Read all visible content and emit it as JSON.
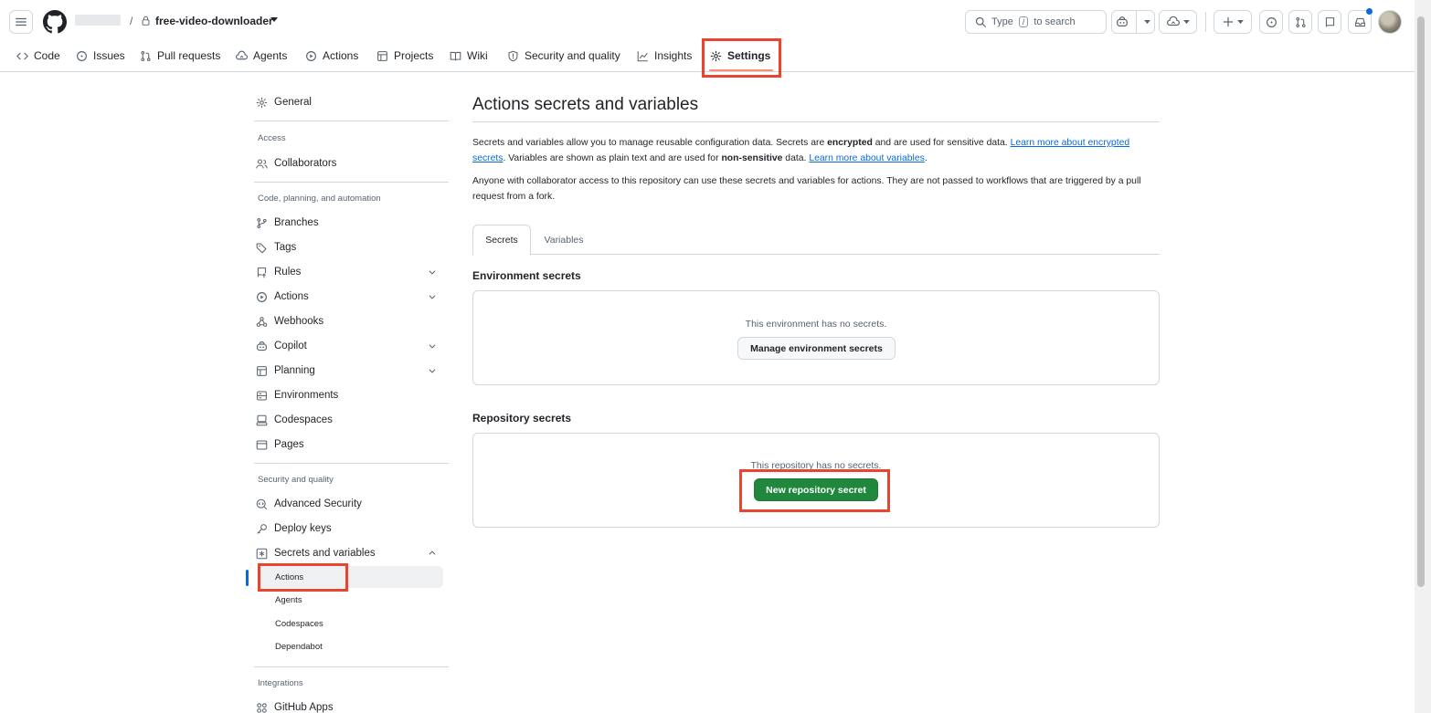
{
  "header": {
    "repo_name": "free-video-downloader",
    "separator": "/",
    "search": {
      "prefix": "Type",
      "key": "/",
      "suffix": "to search"
    }
  },
  "repo_nav": {
    "items": [
      {
        "label": "Code",
        "icon": "code-icon"
      },
      {
        "label": "Issues",
        "icon": "issue-opened-icon"
      },
      {
        "label": "Pull requests",
        "icon": "git-pull-request-icon"
      },
      {
        "label": "Agents",
        "icon": "agent-icon"
      },
      {
        "label": "Actions",
        "icon": "play-icon"
      },
      {
        "label": "Projects",
        "icon": "table-icon"
      },
      {
        "label": "Wiki",
        "icon": "book-icon"
      },
      {
        "label": "Security and quality",
        "icon": "shield-icon"
      },
      {
        "label": "Insights",
        "icon": "graph-icon"
      },
      {
        "label": "Settings",
        "icon": "gear-icon",
        "active": true
      }
    ]
  },
  "sidebar": {
    "general": "General",
    "access_heading": "Access",
    "collaborators": "Collaborators",
    "code_heading": "Code, planning, and automation",
    "branches": "Branches",
    "tags": "Tags",
    "rules": "Rules",
    "actions": "Actions",
    "webhooks": "Webhooks",
    "copilot": "Copilot",
    "planning": "Planning",
    "environments": "Environments",
    "codespaces": "Codespaces",
    "pages": "Pages",
    "security_heading": "Security and quality",
    "advanced_security": "Advanced Security",
    "deploy_keys": "Deploy keys",
    "secrets_and_variables": "Secrets and variables",
    "sub_items": [
      "Actions",
      "Agents",
      "Codespaces",
      "Dependabot"
    ],
    "integrations_heading": "Integrations",
    "github_apps": "GitHub Apps"
  },
  "main": {
    "title": "Actions secrets and variables",
    "desc1": {
      "part1": "Secrets and variables allow you to manage reusable configuration data. Secrets are ",
      "bold1": "encrypted",
      "part2": " and are used for sensitive data. ",
      "link1": "Learn more about encrypted secrets",
      "part3": ". Variables are shown as plain text and are used for ",
      "bold2": "non-sensitive",
      "part4": " data. ",
      "link2": "Learn more about variables",
      "part5": "."
    },
    "desc2": "Anyone with collaborator access to this repository can use these secrets and variables for actions. They are not passed to workflows that are triggered by a pull request from a fork.",
    "tabs": [
      "Secrets",
      "Variables"
    ],
    "env_title": "Environment secrets",
    "env_empty": "This environment has no secrets.",
    "env_button": "Manage environment secrets",
    "repo_title": "Repository secrets",
    "repo_empty": "This repository has no secrets.",
    "repo_button": "New repository secret"
  },
  "colors": {
    "primary_button": "#1f883d",
    "link": "#0969da",
    "highlight_box": "#e8442f",
    "active_tab_underline": "#fd8c73"
  }
}
